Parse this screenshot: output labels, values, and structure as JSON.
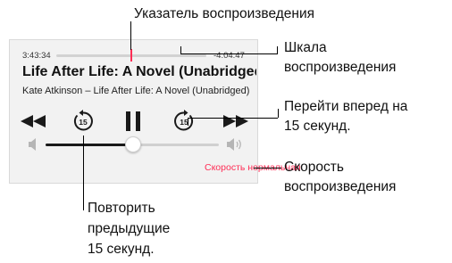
{
  "player": {
    "elapsed": "3:43:34",
    "remaining": "-4:04:47",
    "title": "Life After Life: A Novel (Unabridged)",
    "subtitle": "Kate Atkinson – Life After Life: A Novel (Unabridged)",
    "progress_fraction": 0.49,
    "volume_fraction": 0.5,
    "speed_label": "Скорость нормальная",
    "skip_seconds_icon_label": "15"
  },
  "callouts": {
    "playhead": "Указатель воспроизведения",
    "scrubber_line1": "Шкала",
    "scrubber_line2": "воспроизведения",
    "forward_line1": "Перейти вперед на",
    "forward_line2": "15 секунд.",
    "speed_line1": "Скорость",
    "speed_line2": "воспроизведения",
    "back_line1": "Повторить",
    "back_line2": "предыдущие",
    "back_line3": "15 секунд."
  },
  "colors": {
    "accent": "#ff2d55",
    "panel_bg": "#f2f2f2"
  }
}
